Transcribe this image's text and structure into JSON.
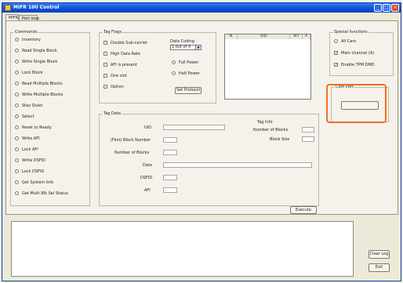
{
  "window": {
    "title": "MIFR 100 Control",
    "minimize": "_",
    "maximize": "□",
    "close": "×"
  },
  "tabs": [
    {
      "label": "MIFR"
    },
    {
      "label": "Port loop"
    }
  ],
  "commands": {
    "title": "Commands",
    "items": [
      {
        "label": "Inventory",
        "selected": true
      },
      {
        "label": "Read Single Block",
        "selected": false
      },
      {
        "label": "Write Single Block",
        "selected": false
      },
      {
        "label": "Lock Block",
        "selected": false
      },
      {
        "label": "Read Multiple Blocks",
        "selected": false
      },
      {
        "label": "Write Multiple Blocks",
        "selected": false
      },
      {
        "label": "Stay Quiet",
        "selected": false
      },
      {
        "label": "Select",
        "selected": false
      },
      {
        "label": "Reset to Ready",
        "selected": false
      },
      {
        "label": "Write AFI",
        "selected": false
      },
      {
        "label": "Lock AFI",
        "selected": false
      },
      {
        "label": "Write DSFID",
        "selected": false
      },
      {
        "label": "Lock DSFID",
        "selected": false
      },
      {
        "label": "Get System Info",
        "selected": false
      },
      {
        "label": "Get Multi Blk Sel Status",
        "selected": false
      }
    ]
  },
  "tag_flags": {
    "title": "Tag Flags",
    "checks": [
      {
        "label": "Double Sub-carrier",
        "checked": false
      },
      {
        "label": "High Data Rate",
        "checked": false
      },
      {
        "label": "AFI is present",
        "checked": false
      },
      {
        "label": "One slot",
        "checked": false
      },
      {
        "label": "Option",
        "checked": false
      }
    ],
    "data_coding_label": "Data Coding",
    "data_coding_value": "1 out of 4",
    "radios": [
      {
        "label": "Full Power",
        "selected": true
      },
      {
        "label": "Half Power",
        "selected": false
      }
    ],
    "set_protocol_label": "Set Protocol"
  },
  "tag_list": {
    "columns": [
      "N",
      "UID",
      "AFI",
      "A"
    ]
  },
  "special_functions": {
    "title": "Special functions",
    "items": [
      {
        "type": "radio",
        "label": "All Cars",
        "checked": false
      },
      {
        "type": "check",
        "label": "Main channel (A)",
        "checked": true
      },
      {
        "type": "check",
        "label": "Enable TPM DMD",
        "checked": true
      }
    ]
  },
  "com_port": {
    "title": "Com Port",
    "button_label": ""
  },
  "tag_data": {
    "title": "Tag Data",
    "uid_label": "UID",
    "first_block_label": "(First) Block Number",
    "num_blocks_label": "Number of Blocks",
    "data_label": "Data",
    "dsfid_label": "DSFID",
    "afi_label": "AFI",
    "tag_info_label": "Tag Info",
    "num_blocks_info_label": "Number of Blocks",
    "block_size_label": "Block Size"
  },
  "execute_label": "Execute",
  "footer": {
    "clear_log_label": "Clear Log",
    "exit_label": "Exit"
  },
  "colors": {
    "titlebar": "#0a4fd6",
    "highlight": "#f07020",
    "window_bg": "#ece9d8"
  }
}
